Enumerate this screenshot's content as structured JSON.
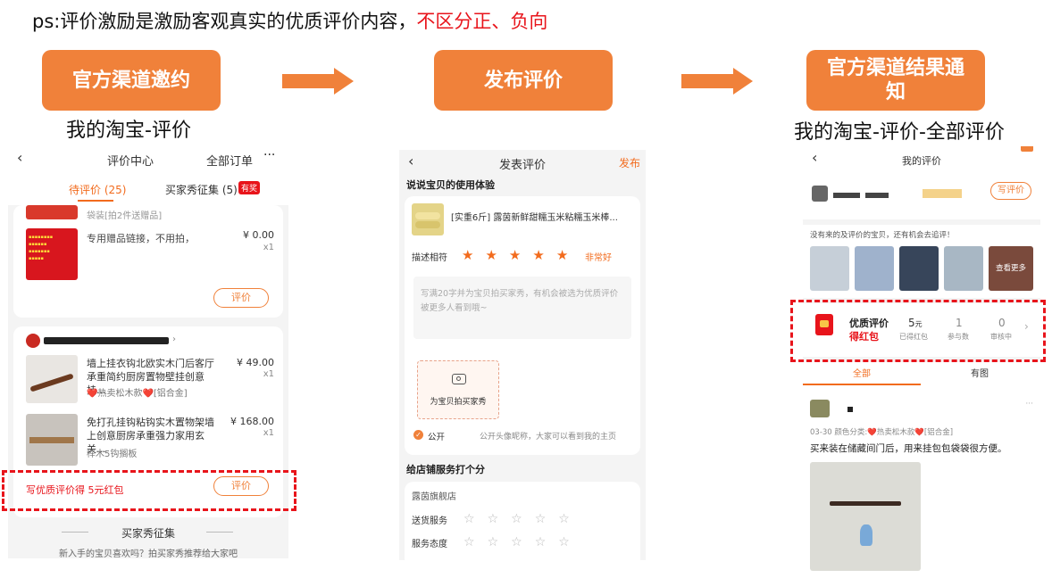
{
  "note": {
    "prefix": "ps:评价激励是激励客观真实的优质评价内容，",
    "highlight": "不区分正、负向"
  },
  "steps": [
    {
      "label": "官方渠道邀约",
      "caption": "我的淘宝-评价"
    },
    {
      "label": "发布评价",
      "caption": ""
    },
    {
      "label": "官方渠道结果通知",
      "caption": "我的淘宝-评价-全部评价"
    }
  ],
  "colors": {
    "accent": "#f0813a",
    "highlight": "#e8141b",
    "star": "#f26b1d"
  },
  "phone1": {
    "title": "评价中心",
    "right_link": "全部订单",
    "more_icon": "more-dots-icon",
    "tabs": [
      {
        "label": "待评价 (25)"
      },
      {
        "label": "买家秀征集 (5)",
        "badge": "有奖"
      }
    ],
    "card1": {
      "partial_item": "袋装[拍2件送赠品]",
      "item_title": "专用赠品链接，不用拍，",
      "item_price": "¥ 0.00",
      "item_qty": "x1",
      "review_btn": "评价"
    },
    "card2": {
      "items": [
        {
          "title": "墙上挂衣钩北欧实木门后客厅承重简约厨房置物壁挂创意挂...",
          "tags": "❤️热卖松木款❤️[铝合金]",
          "price": "¥ 49.00",
          "qty": "x1"
        },
        {
          "title": "免打孔挂钩粘钩实木置物架墙上创意厨房承重强力家用玄关...",
          "tags": "榉木5钩搁板",
          "price": "¥ 168.00",
          "qty": "x1"
        }
      ],
      "incentive_text": "写优质评价得 5元红包",
      "review_btn": "评价"
    },
    "collect_title": "买家秀征集",
    "collect_sub": "新入手的宝贝喜欢吗？拍买家秀推荐给大家吧"
  },
  "phone2": {
    "title": "发表评价",
    "publish": "发布",
    "section1": "说说宝贝的使用体验",
    "product_title": "[实重6斤] 露茵新鲜甜糯玉米粘糯玉米棒...",
    "rating_label": "描述相符",
    "rating_stars": 5,
    "rating_text": "非常好",
    "placeholder": "写满20字并为宝贝拍买家秀，有机会被选为优质评价被更多人看到哦~",
    "photo_btn": "为宝贝拍买家秀",
    "public_label": "公开",
    "public_hint": "公开头像昵称，大家可以看到我的主页",
    "section2": "给店铺服务打个分",
    "shop_name": "露茵旗舰店",
    "service_rows": [
      {
        "label": "送货服务",
        "stars": 0
      },
      {
        "label": "服务态度",
        "stars": 0
      }
    ]
  },
  "phone3": {
    "title": "我的评价",
    "write_btn": "写评价",
    "not_reviewed": "没有来的及评价的宝贝，还有机会去追评！",
    "see_more": "查看更多",
    "quality": {
      "label": "优质评价",
      "sub": "得红包",
      "stats": [
        {
          "value": "5",
          "unit": "元",
          "label": "已得红包"
        },
        {
          "value": "1",
          "unit": "",
          "label": "参与数"
        },
        {
          "value": "0",
          "unit": "",
          "label": "审核中"
        }
      ]
    },
    "tabs": [
      {
        "label": "全部"
      },
      {
        "label": "有图"
      }
    ],
    "review_meta": "03-30 颜色分类:❤️热卖松木款❤️[铝合金]",
    "review_text": "买来装在储藏间门后，用来挂包包袋袋很方便。"
  }
}
